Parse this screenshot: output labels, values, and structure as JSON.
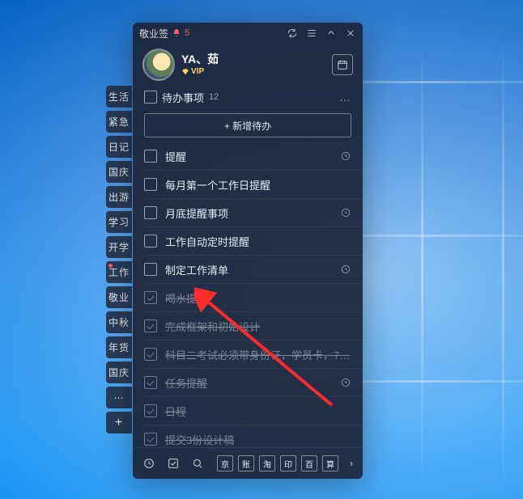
{
  "titlebar": {
    "app_name": "敬业签",
    "notif_count": "5"
  },
  "user": {
    "name": "YA、茹",
    "vip_label": "VIP"
  },
  "side_tabs": {
    "items": [
      {
        "label": "生活"
      },
      {
        "label": "紧急"
      },
      {
        "label": "日记"
      },
      {
        "label": "国庆"
      },
      {
        "label": "出游"
      },
      {
        "label": "学习"
      },
      {
        "label": "开学"
      },
      {
        "label": "工作",
        "dot": true
      },
      {
        "label": "敬业"
      },
      {
        "label": "中秋"
      },
      {
        "label": "年货"
      },
      {
        "label": "国庆"
      }
    ],
    "more": "⋯",
    "plus": "+"
  },
  "section": {
    "title": "待办事项",
    "count": "12",
    "more": "…"
  },
  "add_button": {
    "label": "+ 新增待办"
  },
  "todos": [
    {
      "label": "提醒",
      "done": false,
      "has_clock": true
    },
    {
      "label": "每月第一个工作日提醒",
      "done": false,
      "has_clock": false
    },
    {
      "label": "月底提醒事项",
      "done": false,
      "has_clock": true
    },
    {
      "label": "工作自动定时提醒",
      "done": false,
      "has_clock": false
    },
    {
      "label": "制定工作清单",
      "done": false,
      "has_clock": true
    },
    {
      "label": "喝水提醒",
      "done": true,
      "has_clock": false
    },
    {
      "label": "完成框架和初始设计",
      "done": true,
      "has_clock": false
    },
    {
      "label": "科目二考试必须带身份证，学员卡，7…",
      "done": true,
      "has_clock": false
    },
    {
      "label": "任务提醒",
      "done": true,
      "has_clock": true
    },
    {
      "label": "日程",
      "done": true,
      "has_clock": false
    },
    {
      "label": "提交3份设计稿",
      "done": true,
      "has_clock": false
    }
  ],
  "more_indicator": "⋯",
  "bottom_squares": [
    "京",
    "账",
    "淘",
    "印",
    "百",
    "算"
  ]
}
